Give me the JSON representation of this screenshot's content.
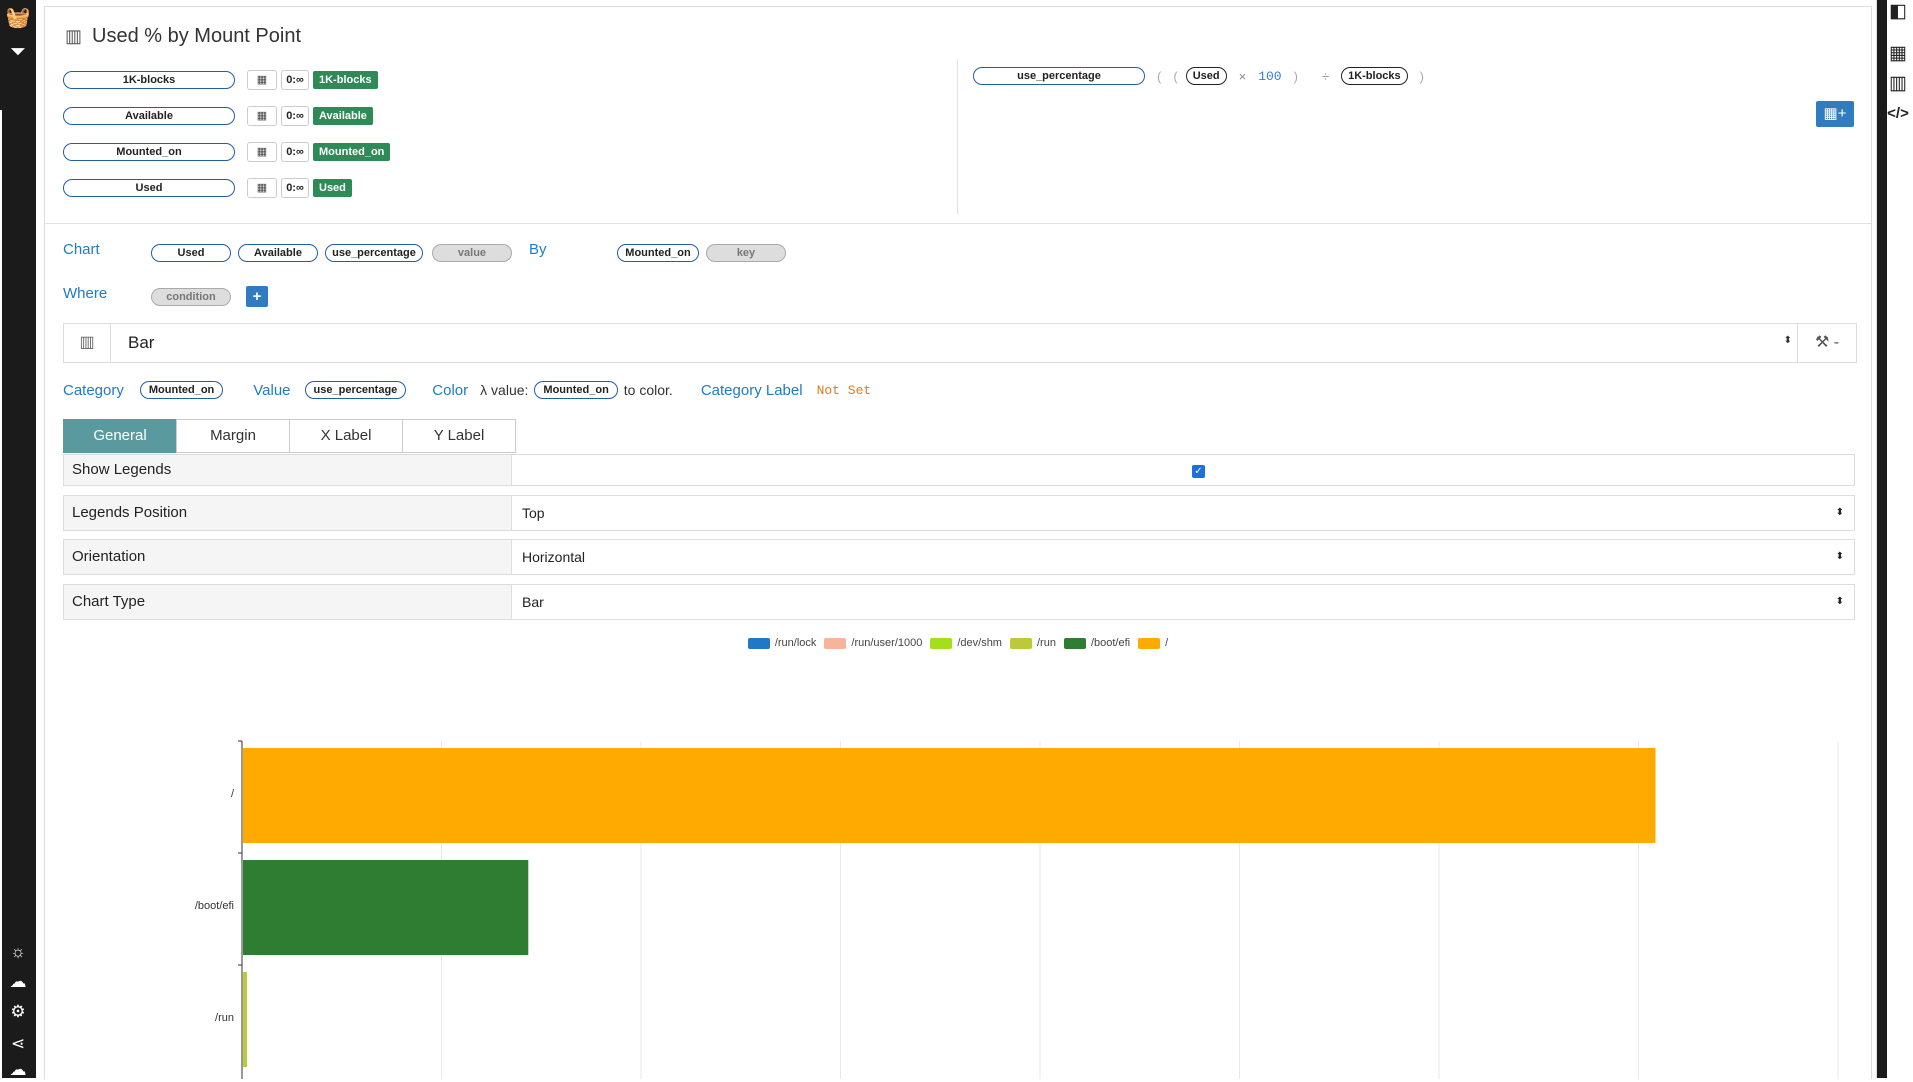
{
  "title": "Used % by Mount Point",
  "fields": [
    {
      "name": "1K-blocks",
      "range": "0:∞",
      "tag": "1K-blocks"
    },
    {
      "name": "Available",
      "range": "0:∞",
      "tag": "Available"
    },
    {
      "name": "Mounted_on",
      "range": "0:∞",
      "tag": "Mounted_on"
    },
    {
      "name": "Used",
      "range": "0:∞",
      "tag": "Used"
    }
  ],
  "formula": {
    "name": "use_percentage",
    "open_outer": "(",
    "open_inner": "(",
    "left_field": "Used",
    "times": "×",
    "number": "100",
    "close_inner": ")",
    "divide": "÷",
    "right_field": "1K-blocks",
    "close_outer": ")"
  },
  "chart_row": {
    "label": "Chart",
    "pills": [
      "Used",
      "Available",
      "use_percentage"
    ],
    "placeholder": "value",
    "by_label": "By",
    "by_pill": "Mounted_on",
    "by_placeholder": "key"
  },
  "where_row": {
    "label": "Where",
    "placeholder": "condition",
    "add": "+"
  },
  "chart_select": {
    "value": "Bar",
    "tool_suffix": "-"
  },
  "mapping": {
    "category_label": "Category",
    "category_value": "Mounted_on",
    "value_label": "Value",
    "value_value": "use_percentage",
    "color_label": "Color",
    "color_prefix": "λ value:",
    "color_field": "Mounted_on",
    "color_suffix": "to color.",
    "category_label_label": "Category Label",
    "category_label_value": "Not Set"
  },
  "tabs": [
    "General",
    "Margin",
    "X Label",
    "Y Label"
  ],
  "properties": {
    "show_legends": {
      "label": "Show Legends",
      "checked": true
    },
    "legends_position": {
      "label": "Legends Position",
      "value": "Top"
    },
    "orientation": {
      "label": "Orientation",
      "value": "Horizontal"
    },
    "chart_type": {
      "label": "Chart Type",
      "value": "Bar"
    }
  },
  "colors": {
    "/run/lock": "#1f78c8",
    "/run/user/1000": "#f8b49a",
    "/dev/shm": "#a3e01a",
    "/run": "#bcc93a",
    "/boot/efi": "#2e7d32",
    "/": "#ffaa00"
  },
  "chart_data": {
    "type": "bar",
    "orientation": "horizontal",
    "legend": [
      "/run/lock",
      "/run/user/1000",
      "/dev/shm",
      "/run",
      "/boot/efi",
      "/"
    ],
    "categories": [
      "/",
      "/boot/efi",
      "/run"
    ],
    "values": [
      70.8,
      14.3,
      0.2
    ],
    "xlim": [
      0,
      80
    ],
    "grid": true,
    "legend_position": "top"
  }
}
